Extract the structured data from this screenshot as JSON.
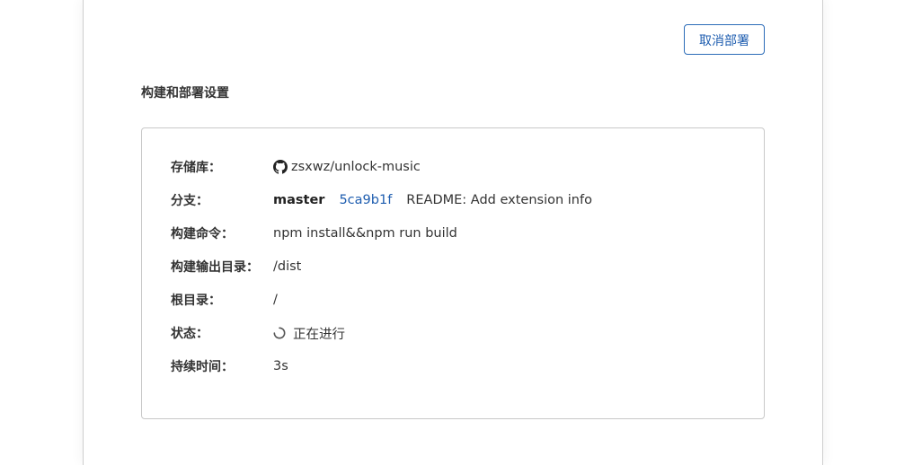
{
  "header": {
    "cancel_button_label": "取消部署"
  },
  "section": {
    "title": "构建和部署设置"
  },
  "details": {
    "repository": {
      "label": "存储库：",
      "icon": "github-icon",
      "value": "zsxwz/unlock-music"
    },
    "branch": {
      "label": "分支：",
      "name": "master",
      "commit_hash": "5ca9b1f",
      "commit_message": "README: Add extension info",
      "commit_hash_color": "#1f5eb0"
    },
    "build_command": {
      "label": "构建命令：",
      "value": "npm install&&npm run build"
    },
    "output_dir": {
      "label": "构建输出目录：",
      "value": "/dist"
    },
    "root_dir": {
      "label": "根目录：",
      "value": "/"
    },
    "status": {
      "label": "状态：",
      "icon": "spinner-icon",
      "value": "正在进行"
    },
    "duration": {
      "label": "持续时间：",
      "value": "3s"
    }
  },
  "colors": {
    "accent": "#1f5eb0",
    "border": "#c8c8c8"
  }
}
